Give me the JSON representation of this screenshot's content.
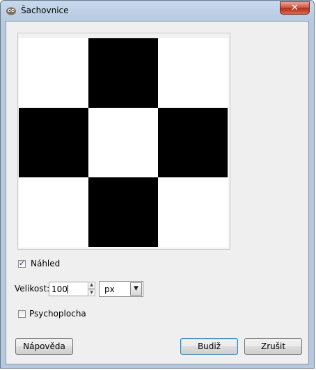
{
  "window": {
    "title": "Šachovnice",
    "close_glyph": "✕",
    "icon": "gimp-wilber-icon"
  },
  "preview": {
    "checkbox_checked": true,
    "label": "Náhled"
  },
  "size": {
    "label": "Velikost:",
    "value": "100",
    "unit": "px",
    "unit_options": [
      "px"
    ]
  },
  "psychoplocha": {
    "checked": false,
    "label": "Psychoplocha"
  },
  "buttons": {
    "help": "Nápověda",
    "ok": "Budiž",
    "cancel": "Zrušit"
  },
  "checkerboard": {
    "pattern": [
      [
        0,
        1,
        0
      ],
      [
        1,
        0,
        1
      ],
      [
        0,
        1,
        0
      ]
    ],
    "dark_color": "#000000",
    "light_color": "#ffffff"
  }
}
